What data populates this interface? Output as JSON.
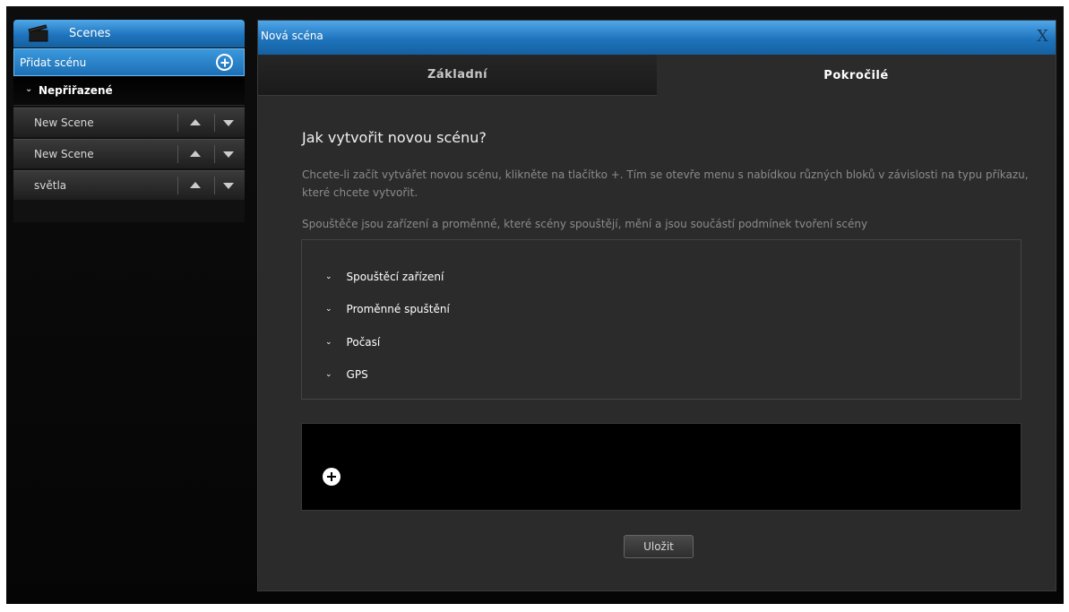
{
  "sidebar": {
    "title": "Scenes",
    "add_label": "Přidat scénu",
    "group_label": "Nepřiřazené",
    "scenes": [
      {
        "label": "New Scene"
      },
      {
        "label": "New Scene"
      },
      {
        "label": "světla"
      }
    ]
  },
  "dialog": {
    "title": "Nová scéna",
    "close_label": "X",
    "tabs": [
      {
        "label": "Základní",
        "active": false
      },
      {
        "label": "Pokročilé",
        "active": true
      }
    ],
    "heading": "Jak vytvořit novou scénu?",
    "description": "Chcete-li začít vytvářet novou scénu, klikněte na tlačítko +. Tím se otevře menu s nabídkou různých bloků v závislosti na typu příkazu, které chcete vytvořit.",
    "trigger_description": "Spouštěče jsou zařízení a proměnné, které scény spouštějí, mění a jsou součástí podmínek tvoření scény",
    "trigger_items": [
      {
        "label": "Spouštěcí zařízení"
      },
      {
        "label": "Proměnné spuštění"
      },
      {
        "label": "Počasí"
      },
      {
        "label": "GPS"
      }
    ],
    "save_label": "Uložit"
  },
  "colors": {
    "header_blue": "#1f74bd",
    "background": "#050505",
    "panel": "#2b2b2b"
  }
}
